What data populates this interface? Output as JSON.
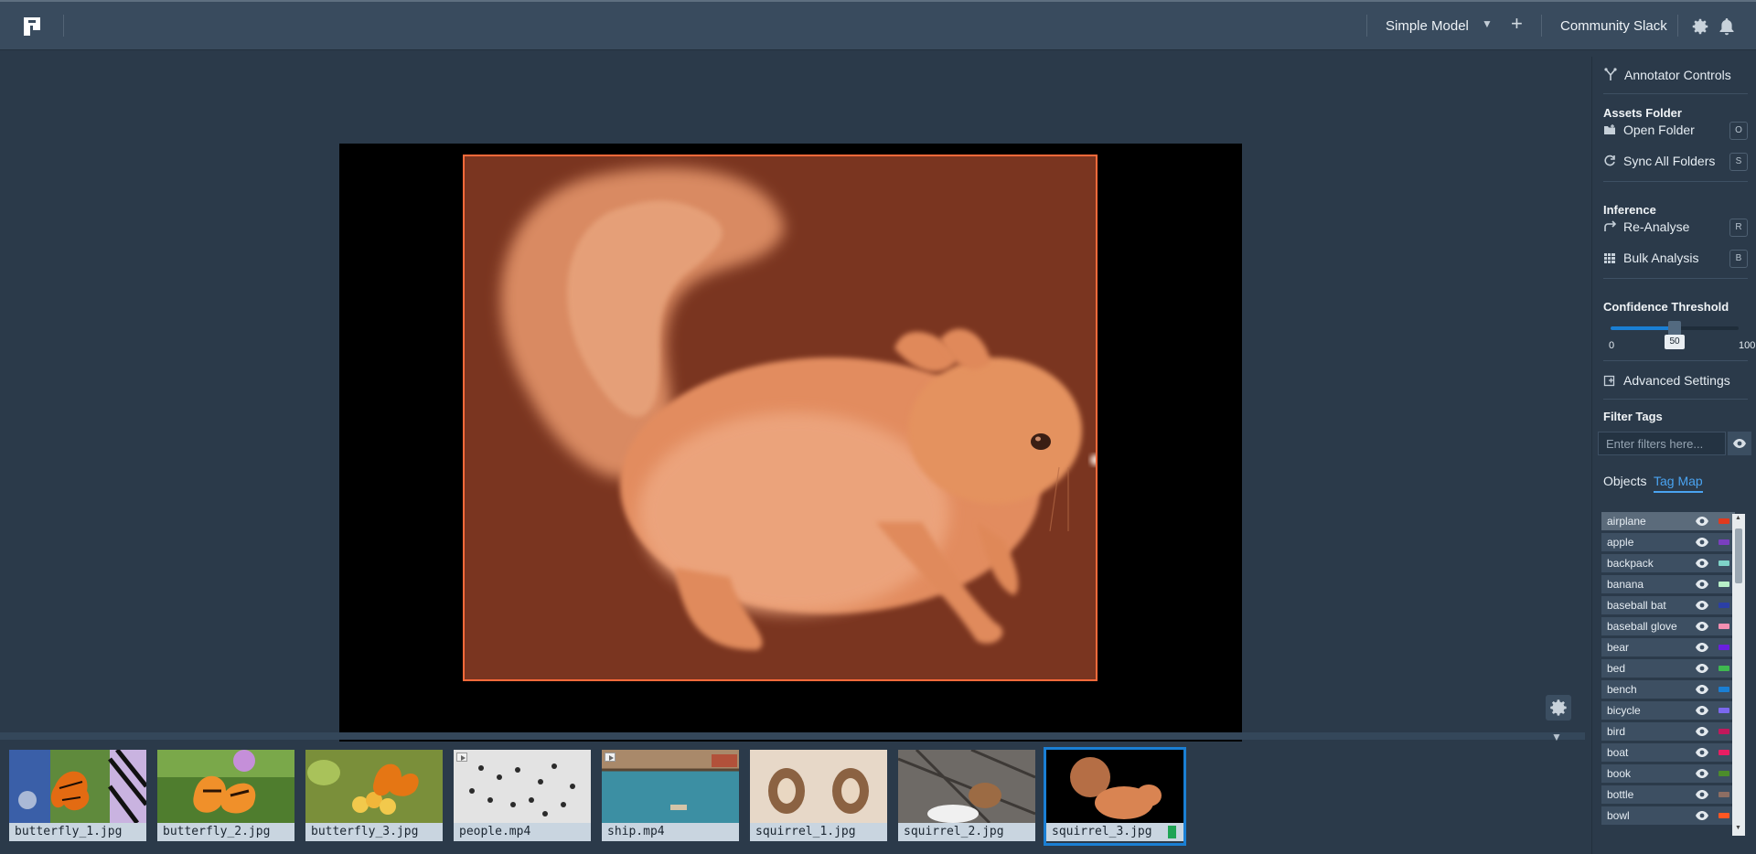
{
  "topbar": {
    "model_name": "Simple Model",
    "add_label": "+",
    "slack_label": "Community Slack"
  },
  "filmstrip": {
    "thumbs": [
      {
        "name": "butterfly_1.jpg",
        "video": false
      },
      {
        "name": "butterfly_2.jpg",
        "video": false
      },
      {
        "name": "butterfly_3.jpg",
        "video": false
      },
      {
        "name": "people.mp4",
        "video": true
      },
      {
        "name": "ship.mp4",
        "video": true
      },
      {
        "name": "squirrel_1.jpg",
        "video": false
      },
      {
        "name": "squirrel_2.jpg",
        "video": false
      },
      {
        "name": "squirrel_3.jpg",
        "video": false,
        "selected": true,
        "bookmarked": true
      }
    ]
  },
  "panel": {
    "header": "Annotator Controls",
    "assets_title": "Assets Folder",
    "open_folder": "Open Folder",
    "open_folder_key": "O",
    "sync_folders": "Sync All Folders",
    "sync_folders_key": "S",
    "inference_title": "Inference",
    "reanalyse": "Re-Analyse",
    "reanalyse_key": "R",
    "bulk": "Bulk Analysis",
    "bulk_key": "B",
    "confidence_title": "Confidence Threshold",
    "confidence_min": "0",
    "confidence_value": "50",
    "confidence_max": "100",
    "advanced": "Advanced Settings",
    "filter_title": "Filter Tags",
    "filter_placeholder": "Enter filters here...",
    "tab_objects": "Objects",
    "tab_tagmap": "Tag Map"
  },
  "tags": [
    {
      "label": "airplane",
      "color": "#e03a1e"
    },
    {
      "label": "apple",
      "color": "#7a3fbf"
    },
    {
      "label": "backpack",
      "color": "#7fd3c8"
    },
    {
      "label": "banana",
      "color": "#b8f0c8"
    },
    {
      "label": "baseball bat",
      "color": "#2b3fa6"
    },
    {
      "label": "baseball glove",
      "color": "#f48fb1"
    },
    {
      "label": "bear",
      "color": "#6a1fe0"
    },
    {
      "label": "bed",
      "color": "#3fb950"
    },
    {
      "label": "bench",
      "color": "#1a7fd4"
    },
    {
      "label": "bicycle",
      "color": "#7b68ee"
    },
    {
      "label": "bird",
      "color": "#c2185b"
    },
    {
      "label": "boat",
      "color": "#e91e63"
    },
    {
      "label": "book",
      "color": "#4c8c2b"
    },
    {
      "label": "bottle",
      "color": "#8d6e63"
    },
    {
      "label": "bowl",
      "color": "#ff5722"
    }
  ]
}
